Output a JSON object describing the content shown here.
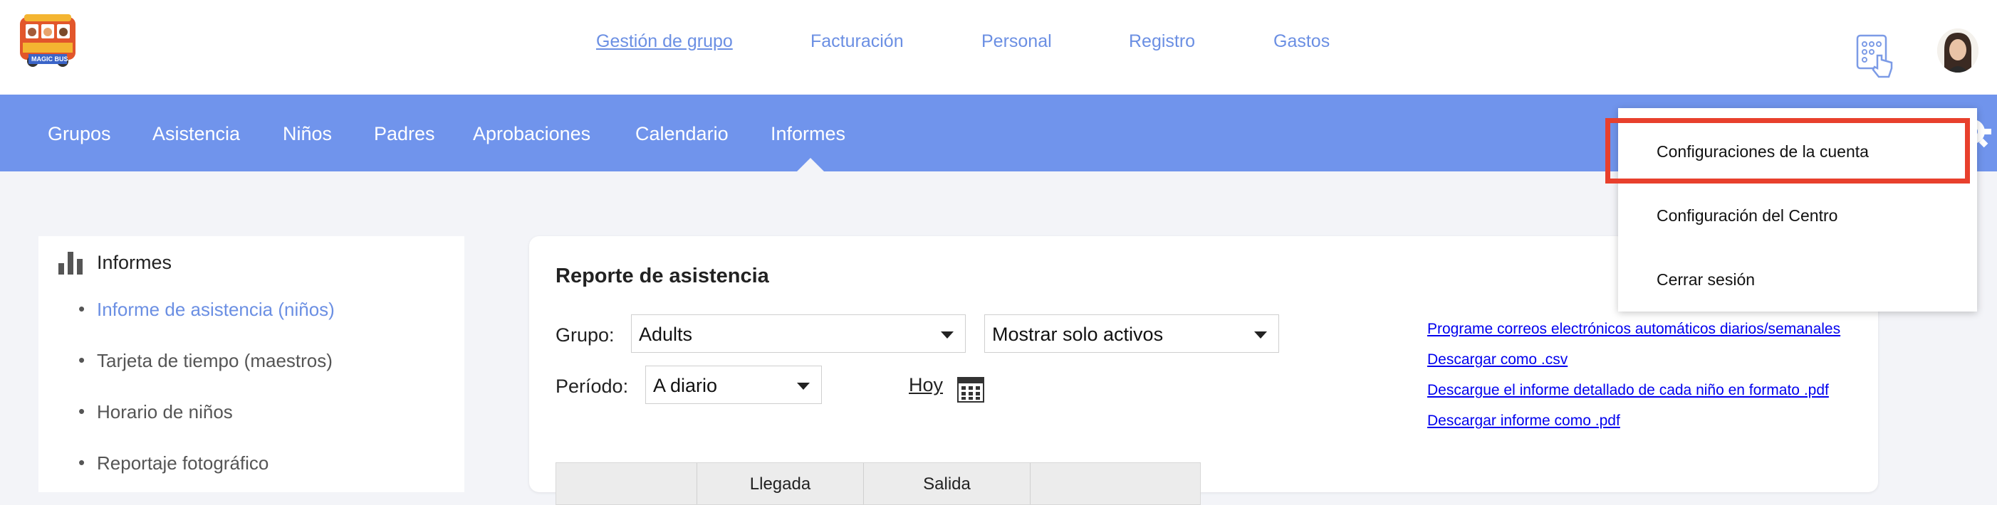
{
  "logo": {
    "text": "MAGIC BUS"
  },
  "top_nav": [
    {
      "label": "Gestión de grupo",
      "active": true
    },
    {
      "label": "Facturación",
      "active": false
    },
    {
      "label": "Personal",
      "active": false
    },
    {
      "label": "Registro",
      "active": false
    },
    {
      "label": "Gastos",
      "active": false
    }
  ],
  "main_nav": [
    "Grupos",
    "Asistencia",
    "Niños",
    "Padres",
    "Aprobaciones",
    "Calendario",
    "Informes"
  ],
  "sidebar": {
    "heading": "Informes",
    "items": [
      {
        "label": "Informe de asistencia (niños)",
        "active": true
      },
      {
        "label": "Tarjeta de tiempo (maestros)",
        "active": false
      },
      {
        "label": "Horario de niños",
        "active": false
      },
      {
        "label": "Reportaje fotográfico",
        "active": false
      }
    ]
  },
  "report": {
    "title": "Reporte de asistencia",
    "group_label": "Grupo:",
    "group_value": "Adults",
    "status_value": "Mostrar solo activos",
    "period_label": "Período:",
    "period_value": "A diario",
    "today_label": "Hoy",
    "links": [
      "Programe correos electrónicos automáticos diarios/semanales",
      "Descargar como .csv",
      "Descargue el informe detallado de cada niño en formato .pdf",
      "Descargar informe como .pdf"
    ],
    "table_headers": [
      "",
      "Llegada",
      "Salida",
      ""
    ]
  },
  "account_menu": {
    "items": [
      "Configuraciones de la cuenta",
      "Configuración del Centro",
      "Cerrar sesión"
    ]
  },
  "colors": {
    "nav_bg": "#7094ec",
    "link": "#6b8fe3",
    "highlight": "#e8402d"
  }
}
